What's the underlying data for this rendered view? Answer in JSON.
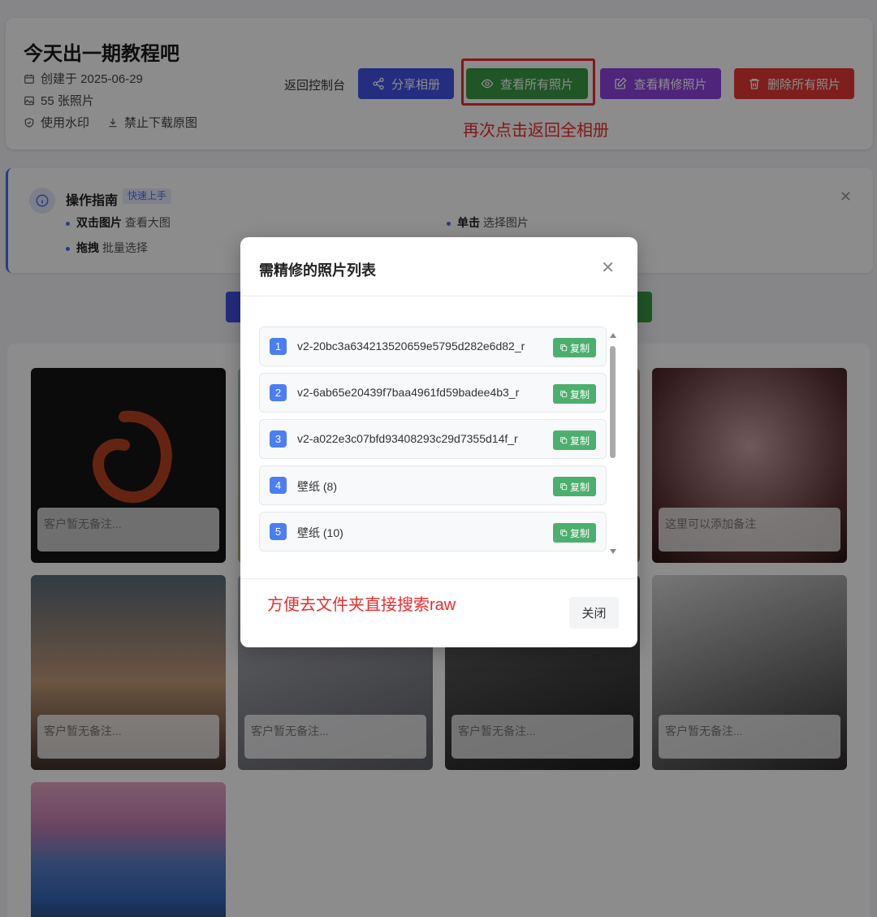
{
  "header": {
    "title": "今天出一期教程吧",
    "created": "创建于 2025-06-29",
    "count": "55 张照片",
    "watermark": "使用水印",
    "no_download": "禁止下载原图",
    "back": "返回控制台",
    "share": "分享相册",
    "view_all": "查看所有照片",
    "view_retouch": "查看精修照片",
    "delete_all": "删除所有照片",
    "annotation": "再次点击返回全相册"
  },
  "guide": {
    "title": "操作指南",
    "badge": "快速上手",
    "items": [
      {
        "bold": "双击图片",
        "text": "查看大图"
      },
      {
        "bold": "单击",
        "text": "选择图片"
      },
      {
        "bold": "拖拽",
        "text": "批量选择"
      }
    ]
  },
  "gallery": {
    "notes": [
      "客户暂无备注...",
      "这里可以添加备注",
      "客户暂无备注...",
      "客户暂无备注...",
      "客户暂无备注...",
      "客户暂无备注..."
    ]
  },
  "modal": {
    "title": "需精修的照片列表",
    "copy_label": "复制",
    "items": [
      {
        "num": "1",
        "name": "v2-20bc3a634213520659e5795d282e6d82_r"
      },
      {
        "num": "2",
        "name": "v2-6ab65e20439f7baa4961fd59badee4b3_r"
      },
      {
        "num": "3",
        "name": "v2-a022e3c07bfd93408293c29d7355d14f_r"
      },
      {
        "num": "4",
        "name": "壁纸 (8)"
      },
      {
        "num": "5",
        "name": "壁纸 (10)"
      }
    ],
    "annotation": "方便去文件夹直接搜索raw",
    "close": "关闭"
  },
  "colors": {
    "primary": "#4353e8",
    "success": "#3b9b45",
    "purple": "#8e44e0",
    "danger": "#e53935",
    "annotation": "#ee2b2b"
  }
}
